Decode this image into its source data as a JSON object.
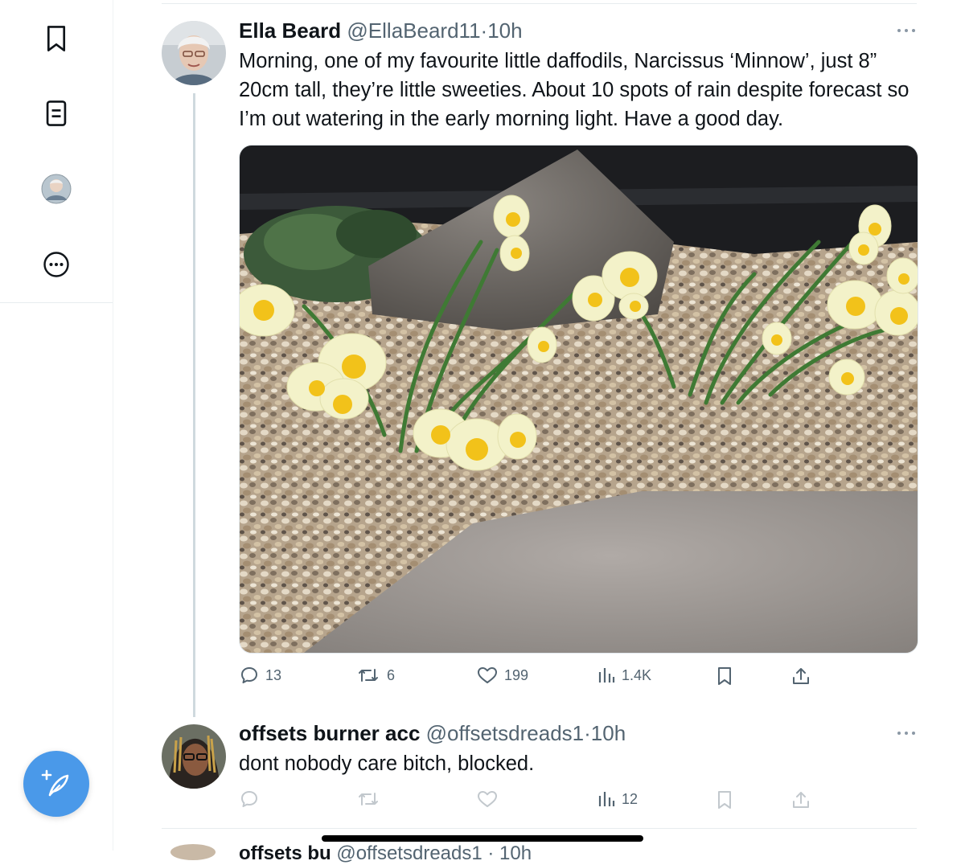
{
  "sidebar": {
    "items": [
      {
        "icon": "bookmark-icon"
      },
      {
        "icon": "list-icon"
      },
      {
        "icon": "profile-avatar"
      },
      {
        "icon": "more-circle-icon"
      }
    ],
    "compose_icon": "feather-plus-icon"
  },
  "tweets": [
    {
      "name": "Ella Beard",
      "handle": "@EllaBeard11",
      "separator": "·",
      "time": "10h",
      "text": "Morning, one of my favourite little daffodils, Narcissus ‘Minnow’, just 8” 20cm tall, they’re little sweeties. About 10 spots of rain despite forecast so I’m out watering in the early morning light. Have a good day.",
      "actions": {
        "replies": "13",
        "retweets": "6",
        "likes": "199",
        "views": "1.4K"
      }
    },
    {
      "name": "offsets burner acc",
      "handle": "@offsetsdreads1",
      "separator": "·",
      "time": "10h",
      "text": "dont nobody care bitch, blocked.",
      "actions": {
        "views": "12"
      }
    }
  ],
  "peek": {
    "name": "offsets bu",
    "handle": "@offsetsdreads1 · 10h"
  },
  "colors": {
    "accent": "#1d9bf0",
    "compose": "#4a99e9",
    "secondary_text": "#536471",
    "divider": "#eff3f4"
  }
}
